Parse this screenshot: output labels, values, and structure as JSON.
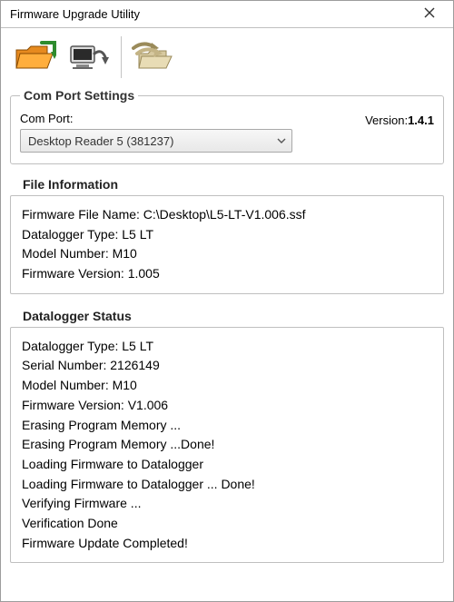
{
  "window": {
    "title": "Firmware Upgrade Utility"
  },
  "toolbar": {
    "open_icon": "open-folder-icon",
    "upload_icon": "upload-device-icon",
    "redo_icon": "redo-folder-icon"
  },
  "comport": {
    "legend": "Com Port Settings",
    "label": "Com Port:",
    "selected": "Desktop Reader 5 (381237)",
    "version_label": "Version:",
    "version_value": "1.4.1"
  },
  "file_info": {
    "heading": "File Information",
    "lines": [
      "Firmware File Name: C:\\Desktop\\L5-LT-V1.006.ssf",
      "Datalogger Type: L5 LT",
      "Model Number: M10",
      "Firmware Version: 1.005"
    ]
  },
  "status": {
    "heading": "Datalogger Status",
    "lines": [
      "Datalogger Type: L5 LT",
      "Serial Number: 2126149",
      "Model Number: M10",
      "Firmware Version: V1.006",
      "Erasing Program Memory ...",
      "Erasing Program Memory ...Done!",
      "Loading Firmware to Datalogger",
      "Loading Firmware to Datalogger ... Done!",
      "Verifying Firmware ...",
      "Verification Done",
      "Firmware Update Completed!"
    ]
  }
}
